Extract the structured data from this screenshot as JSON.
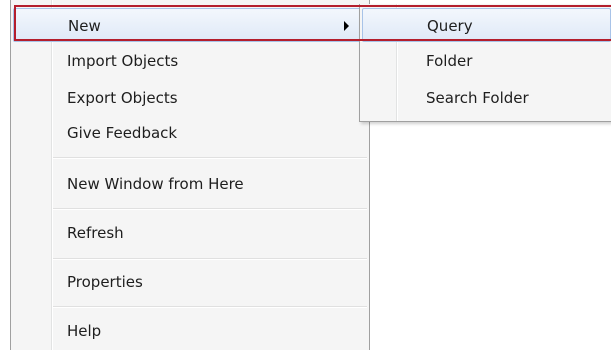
{
  "context_menu": {
    "items": [
      {
        "label": "New",
        "has_submenu": true
      },
      {
        "label": "Import Objects"
      },
      {
        "label": "Export Objects"
      },
      {
        "label": "Give Feedback"
      },
      {
        "label": "New Window from Here"
      },
      {
        "label": "Refresh"
      },
      {
        "label": "Properties"
      },
      {
        "label": "Help"
      }
    ]
  },
  "submenu": {
    "items": [
      {
        "label": "Query"
      },
      {
        "label": "Folder"
      },
      {
        "label": "Search Folder"
      }
    ]
  },
  "colors": {
    "highlight_outline": "#b41e2c",
    "hover_fill": "#dfe9f7"
  }
}
